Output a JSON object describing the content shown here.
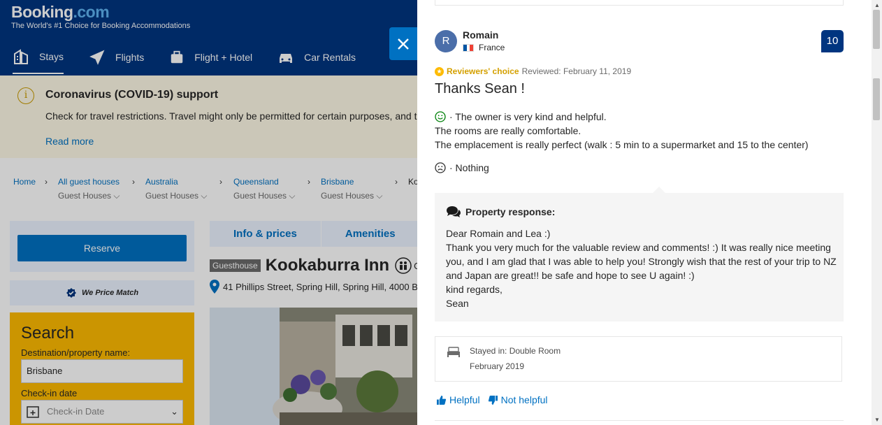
{
  "site": {
    "logo_main": "Booking",
    "logo_suffix": ".com",
    "tagline": "The World's #1 Choice for Booking Accommodations"
  },
  "nav": {
    "stays": "Stays",
    "flights": "Flights",
    "flight_hotel": "Flight + Hotel",
    "car_rentals": "Car Rentals"
  },
  "covid": {
    "title": "Coronavirus (COVID-19) support",
    "text": "Check for travel restrictions. Travel might only be permitted for certain purposes, and t",
    "read_more": "Read more"
  },
  "breadcrumbs": [
    {
      "top": "Home",
      "sub": ""
    },
    {
      "top": "All guest houses",
      "sub": "Guest Houses"
    },
    {
      "top": "Australia",
      "sub": "Guest Houses"
    },
    {
      "top": "Queensland",
      "sub": "Guest Houses"
    },
    {
      "top": "Brisbane",
      "sub": "Guest Houses"
    },
    {
      "top": "Ko",
      "sub": ""
    }
  ],
  "sidebar": {
    "reserve": "Reserve",
    "price_match": "We Price Match",
    "search_title": "Search",
    "destination_label": "Destination/property name:",
    "destination_value": "Brisbane",
    "checkin_label": "Check-in date",
    "checkin_placeholder": "Check-in Date"
  },
  "property": {
    "tabs": [
      "Info & prices",
      "Amenities"
    ],
    "badge": "Guesthouse",
    "name": "Kookaburra Inn",
    "name_suffix": "G",
    "address": "41 Phillips Street, Spring Hill, Spring Hill, 4000 B"
  },
  "review": {
    "avatar_letter": "R",
    "name": "Romain",
    "country": "France",
    "score": "10",
    "reviewers_choice": "Reviewers' choice",
    "reviewed_date": "Reviewed: February 11, 2019",
    "title": "Thanks Sean !",
    "positive_lines": [
      "· The owner is very kind and helpful.",
      "The rooms are really comfortable.",
      "The emplacement is really perfect (walk : 5 min to a supermarket and 15 to the center)"
    ],
    "negative": "· Nothing",
    "response_heading": "Property response:",
    "response_lines": [
      "Dear Romain and Lea :)",
      "Thank you very much for the valuable review and comments! :) It was really nice meeting you, and I am glad that I was able to help you! Strongly wish that the rest of your trip to NZ and Japan are great!! be safe and hope to see U again! :)",
      "kind regards,",
      "Sean"
    ],
    "stayed_in": "Stayed in: Double Room",
    "stay_date": "February 2019",
    "helpful": "Helpful",
    "not_helpful": "Not helpful"
  },
  "colors": {
    "brand_blue": "#003580",
    "link_blue": "#0071c2",
    "search_yellow": "#febb02"
  }
}
